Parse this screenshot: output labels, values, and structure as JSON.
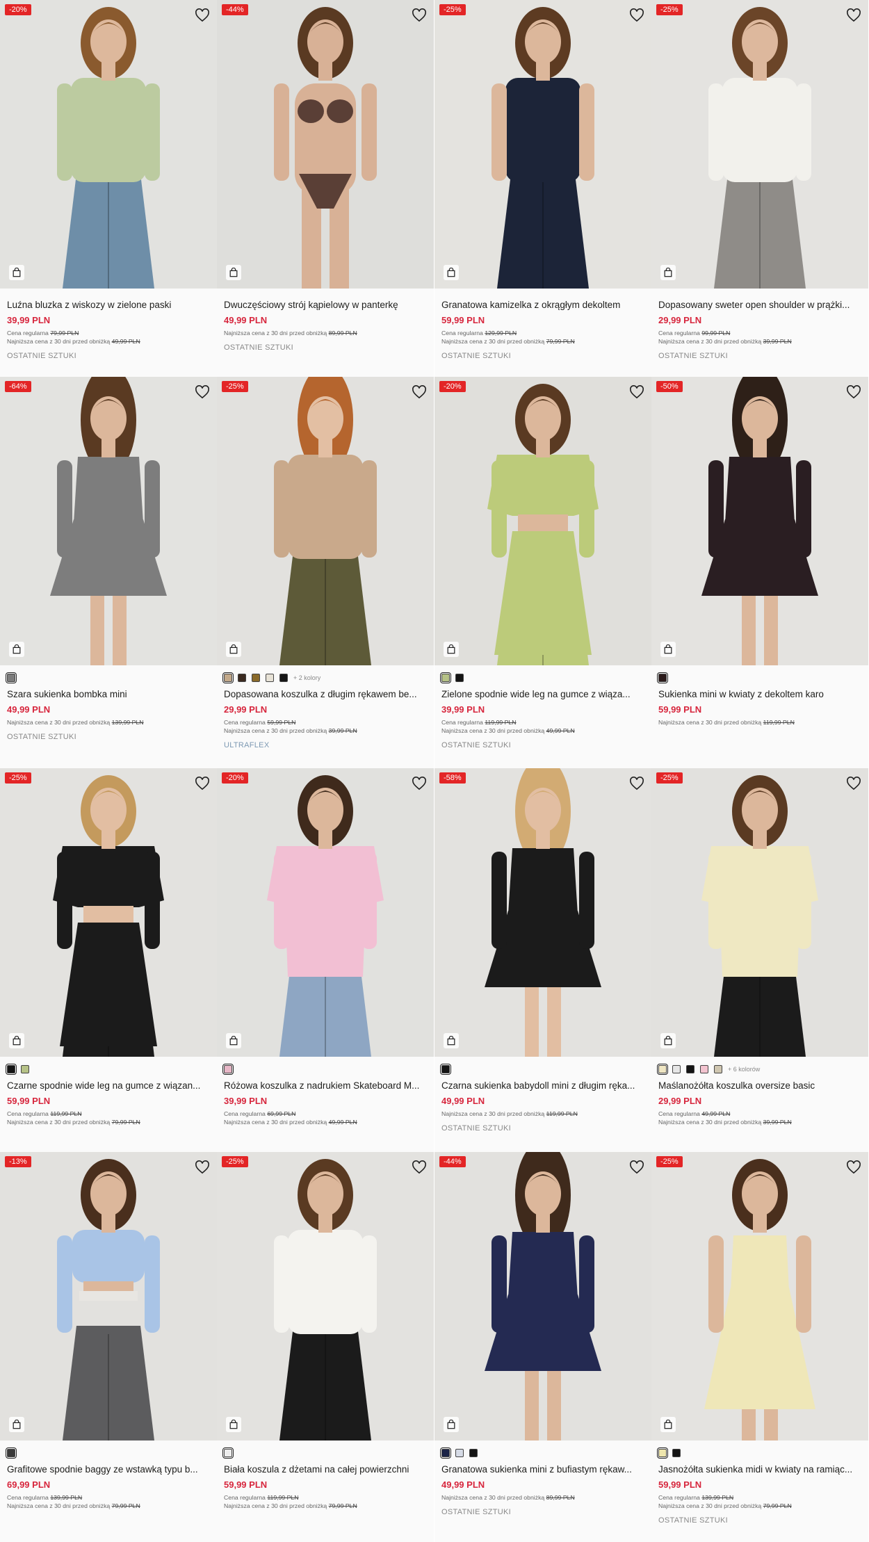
{
  "accent": "#e32526",
  "price_color": "#d7263d",
  "labels": {
    "regular_prefix": "Cena regularna",
    "lowest_prefix": "Najniższa cena z 30 dni przed obniżką"
  },
  "products": [
    {
      "badge": "-20%",
      "name": "Luźna bluzka z wiskozy w zielone paski",
      "price": "39,99 PLN",
      "regular": "79,99 PLN",
      "lowest": "49,99 PLN",
      "tag": "OSTATNIE SZTUKI",
      "bg": "#e2e2df",
      "top": "#bccba0",
      "bottom": "#6e8ea8",
      "hair": "#8a5a2e",
      "skin": "#ddb89c",
      "style": "shirt"
    },
    {
      "badge": "-44%",
      "name": "Dwuczęściowy strój kąpielowy w panterkę",
      "price": "49,99 PLN",
      "regular": "",
      "lowest": "89,99 PLN",
      "tag": "OSTATNIE SZTUKI",
      "bg": "#dededb",
      "top": "#5a3f36",
      "bottom": "#5a3f36",
      "hair": "#5a3a22",
      "skin": "#d8b196",
      "style": "bikini"
    },
    {
      "badge": "-25%",
      "name": "Granatowa kamizelka z okrągłym dekoltem",
      "price": "59,99 PLN",
      "regular": "129,99 PLN",
      "lowest": "79,99 PLN",
      "tag": "OSTATNIE SZTUKI",
      "bg": "#e4e3df",
      "top": "#1c2438",
      "bottom": "#1c2438",
      "hair": "#5d3b22",
      "skin": "#dcb79b",
      "style": "vest"
    },
    {
      "badge": "-25%",
      "name": "Dopasowany sweter open shoulder w prążki...",
      "price": "29,99 PLN",
      "regular": "99,99 PLN",
      "lowest": "39,99 PLN",
      "tag": "OSTATNIE SZTUKI",
      "bg": "#e4e3e0",
      "top": "#f2f1ec",
      "bottom": "#8f8c88",
      "hair": "#6b4528",
      "skin": "#ddb89d",
      "style": "sweater"
    },
    {
      "badge": "-64%",
      "swatches": [
        {
          "c": "#7c7c7c",
          "sel": true
        }
      ],
      "name": "Szara sukienka bombka mini",
      "price": "49,99 PLN",
      "regular": "",
      "lowest": "139,99 PLN",
      "tag": "OSTATNIE SZTUKI",
      "bg": "#e3e3e0",
      "top": "#7d7d7d",
      "bottom": "#7d7d7d",
      "hair": "#5a3a22",
      "skin": "#dcb79b",
      "style": "dress"
    },
    {
      "badge": "-25%",
      "swatches": [
        {
          "c": "#c3a98a",
          "sel": true
        },
        {
          "c": "#3b2a20"
        },
        {
          "c": "#8a6a2a"
        },
        {
          "c": "#e7e2d6"
        },
        {
          "c": "#151515"
        }
      ],
      "more": "+ 2 kolory",
      "name": "Dopasowana koszulka z długim rękawem be...",
      "price": "29,99 PLN",
      "regular": "59,99 PLN",
      "lowest": "39,99 PLN",
      "tag": "ULTRAFLEX",
      "brand": true,
      "bg": "#e2e1de",
      "top": "#c9a98b",
      "bottom": "#5d5a38",
      "hair": "#b5652e",
      "skin": "#e3bfa3",
      "style": "longsleeve"
    },
    {
      "badge": "-20%",
      "swatches": [
        {
          "c": "#b6c287",
          "sel": true
        },
        {
          "c": "#141414"
        }
      ],
      "name": "Zielone spodnie wide leg na gumce z wiąza...",
      "price": "39,99 PLN",
      "regular": "119,99 PLN",
      "lowest": "49,99 PLN",
      "tag": "OSTATNIE SZTUKI",
      "bg": "#e0dfdb",
      "top": "#bccb7a",
      "bottom": "#bccb7a",
      "hair": "#5a3a22",
      "skin": "#dcb79b",
      "style": "set"
    },
    {
      "badge": "-50%",
      "swatches": [
        {
          "c": "#2b1a1a",
          "sel": true
        }
      ],
      "name": "Sukienka mini w kwiaty z dekoltem karo",
      "price": "59,99 PLN",
      "regular": "",
      "lowest": "119,99 PLN",
      "tag": "",
      "bg": "#e4e3e0",
      "top": "#2a1e22",
      "bottom": "#2a1e22",
      "hair": "#2e2018",
      "skin": "#dcb79b",
      "style": "dress"
    },
    {
      "badge": "-25%",
      "swatches": [
        {
          "c": "#141414",
          "sel": true
        },
        {
          "c": "#b6c287"
        }
      ],
      "name": "Czarne spodnie wide leg na gumce z wiązan...",
      "price": "59,99 PLN",
      "regular": "119,99 PLN",
      "lowest": "79,99 PLN",
      "tag": "",
      "bg": "#e3e2df",
      "top": "#1b1b1b",
      "bottom": "#1b1b1b",
      "hair": "#c49a5d",
      "skin": "#e2bea2",
      "style": "set"
    },
    {
      "badge": "-20%",
      "swatches": [
        {
          "c": "#e8b7c7",
          "sel": true
        }
      ],
      "name": "Różowa koszulka z nadrukiem Skateboard M...",
      "price": "39,99 PLN",
      "regular": "69,99 PLN",
      "lowest": "49,99 PLN",
      "tag": "",
      "bg": "#e1e1de",
      "top": "#f2bfd3",
      "bottom": "#8ea6c3",
      "hair": "#3f2a1c",
      "skin": "#dcb79b",
      "style": "tee"
    },
    {
      "badge": "-58%",
      "swatches": [
        {
          "c": "#141414",
          "sel": true
        }
      ],
      "name": "Czarna sukienka babydoll mini z długim ręka...",
      "price": "49,99 PLN",
      "regular": "",
      "lowest": "119,99 PLN",
      "tag": "OSTATNIE SZTUKI",
      "bg": "#e3e2df",
      "top": "#1b1b1b",
      "bottom": "#1b1b1b",
      "hair": "#d2ab73",
      "skin": "#e2bea2",
      "style": "dress"
    },
    {
      "badge": "-25%",
      "swatches": [
        {
          "c": "#efe6c3",
          "sel": true
        },
        {
          "c": "#e6e6e6"
        },
        {
          "c": "#141414"
        },
        {
          "c": "#f2c3cf"
        },
        {
          "c": "#cfc6b0"
        }
      ],
      "more": "+ 6 kolorów",
      "name": "Maślanożółta koszulka oversize basic",
      "price": "29,99 PLN",
      "regular": "49,99 PLN",
      "lowest": "39,99 PLN",
      "tag": "",
      "bg": "#e2e1de",
      "top": "#efe8c2",
      "bottom": "#1b1b1b",
      "hair": "#5a3a22",
      "skin": "#dcb79b",
      "style": "tee"
    },
    {
      "badge": "-13%",
      "swatches": [
        {
          "c": "#3a3a3a",
          "sel": true
        }
      ],
      "name": "Grafitowe spodnie baggy ze wstawką typu b...",
      "price": "69,99 PLN",
      "regular": "139,99 PLN",
      "lowest": "79,99 PLN",
      "tag": "",
      "bg": "#e2e1de",
      "top": "#a9c4e6",
      "bottom": "#5c5c5e",
      "hair": "#4a2f1d",
      "skin": "#dcb79b",
      "style": "crop"
    },
    {
      "badge": "-25%",
      "swatches": [
        {
          "c": "#ededed",
          "sel": true
        }
      ],
      "name": "Biała koszula z dżetami na całej powierzchni",
      "price": "59,99 PLN",
      "regular": "119,99 PLN",
      "lowest": "79,99 PLN",
      "tag": "",
      "bg": "#e3e2df",
      "top": "#f4f3ef",
      "bottom": "#1b1b1b",
      "hair": "#5a3a22",
      "skin": "#dcb79b",
      "style": "shirt"
    },
    {
      "badge": "-44%",
      "swatches": [
        {
          "c": "#1c2448",
          "sel": true
        },
        {
          "c": "#d6dbe6"
        },
        {
          "c": "#141414"
        }
      ],
      "name": "Granatowa sukienka mini z bufiastym rękaw...",
      "price": "49,99 PLN",
      "regular": "",
      "lowest": "89,99 PLN",
      "tag": "OSTATNIE SZTUKI",
      "bg": "#e2e1de",
      "top": "#242a52",
      "bottom": "#242a52",
      "hair": "#3f2a1c",
      "skin": "#dcb79b",
      "style": "dress"
    },
    {
      "badge": "-25%",
      "swatches": [
        {
          "c": "#eee6ad",
          "sel": true
        },
        {
          "c": "#141414"
        }
      ],
      "name": "Jasnożółta sukienka midi w kwiaty na ramiąc...",
      "price": "59,99 PLN",
      "regular": "139,99 PLN",
      "lowest": "79,99 PLN",
      "tag": "OSTATNIE SZTUKI",
      "bg": "#e4e3e0",
      "top": "#efe7b8",
      "bottom": "#efe7b8",
      "hair": "#4a2f1d",
      "skin": "#dcb79b",
      "style": "midi"
    }
  ]
}
